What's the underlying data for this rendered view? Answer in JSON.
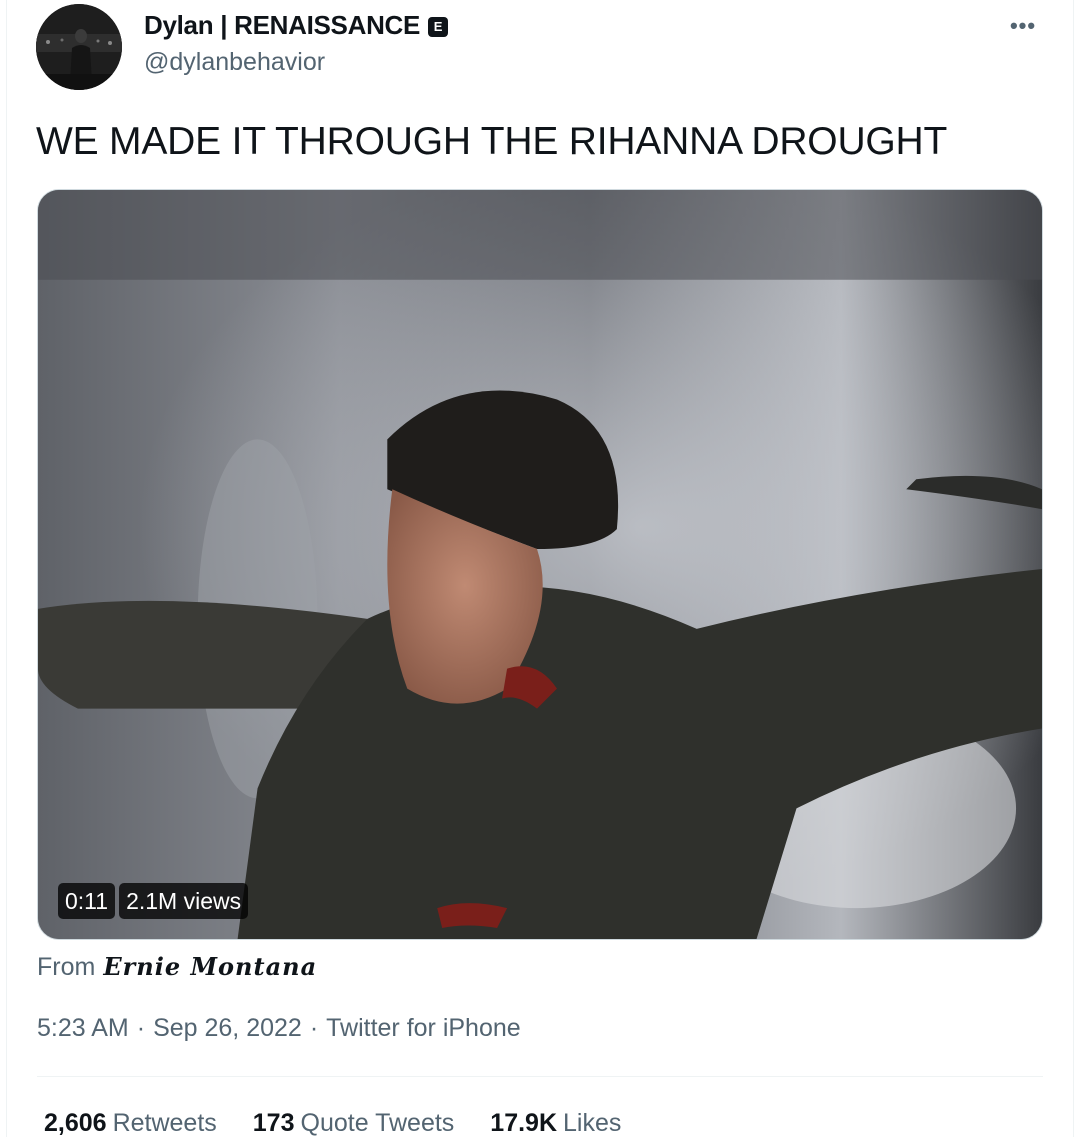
{
  "author": {
    "display_name": "Dylan | RENAISSANCE",
    "badge": "E",
    "handle": "@dylanbehavior"
  },
  "more_icon": "•••",
  "tweet_text": "WE MADE IT THROUGH THE RIHANNA DROUGHT",
  "video": {
    "duration": "0:11",
    "views": "2.1M views"
  },
  "source": {
    "prefix": "From",
    "name": "Ernie Montana"
  },
  "meta": {
    "time": "5:23 AM",
    "separator": "·",
    "date": "Sep 26, 2022",
    "client": "Twitter for iPhone"
  },
  "stats": {
    "retweets_count": "2,606",
    "retweets_label": "Retweets",
    "quote_count": "173",
    "quote_label": "Quote Tweets",
    "likes_count": "17.9K",
    "likes_label": "Likes"
  },
  "colors": {
    "text_primary": "#0f1419",
    "text_secondary": "#536471",
    "border": "#eff3f4"
  }
}
